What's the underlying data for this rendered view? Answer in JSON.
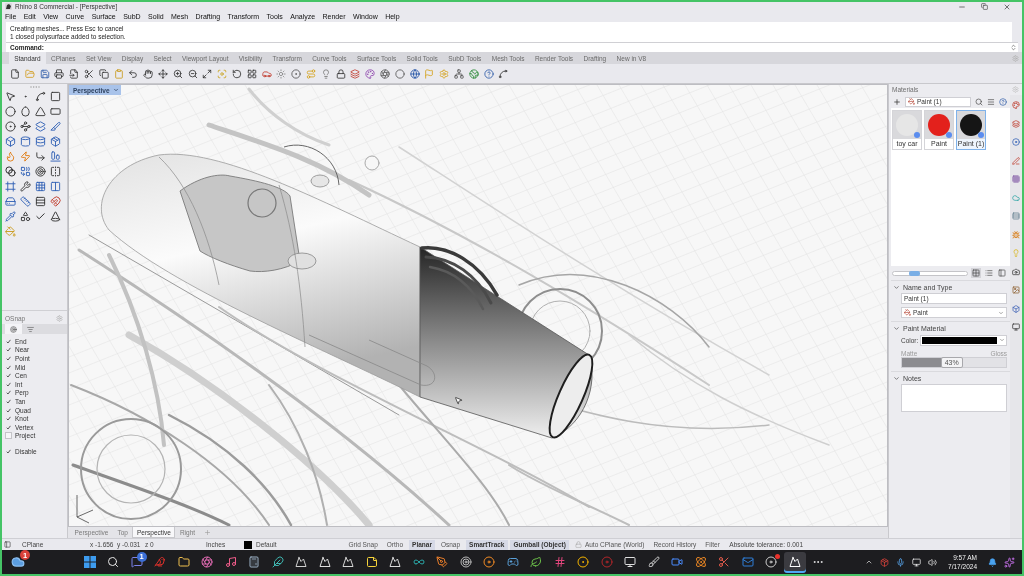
{
  "window": {
    "title": "Rhino 8 Commercial - [Perspective]"
  },
  "menu": [
    "File",
    "Edit",
    "View",
    "Curve",
    "Surface",
    "SubD",
    "Solid",
    "Mesh",
    "Drafting",
    "Transform",
    "Tools",
    "Analyze",
    "Render",
    "Window",
    "Help"
  ],
  "command_history": [
    "Creating meshes... Press Esc to cancel",
    "1 closed polysurface added to selection."
  ],
  "command_prompt": "Command:",
  "ribbon_tabs": [
    {
      "label": "Standard",
      "selected": true
    },
    {
      "label": "CPlanes",
      "selected": false
    },
    {
      "label": "Set View",
      "selected": false
    },
    {
      "label": "Display",
      "selected": false
    },
    {
      "label": "Select",
      "selected": false
    },
    {
      "label": "Viewport Layout",
      "selected": false
    },
    {
      "label": "Visibility",
      "selected": false
    },
    {
      "label": "Transform",
      "selected": false
    },
    {
      "label": "Curve Tools",
      "selected": false
    },
    {
      "label": "Surface Tools",
      "selected": false
    },
    {
      "label": "Solid Tools",
      "selected": false
    },
    {
      "label": "SubD Tools",
      "selected": false
    },
    {
      "label": "Mesh Tools",
      "selected": false
    },
    {
      "label": "Render Tools",
      "selected": false
    },
    {
      "label": "Drafting",
      "selected": false
    },
    {
      "label": "New in V8",
      "selected": false
    }
  ],
  "osnap": {
    "title": "OSnap",
    "tabs": [
      {
        "selected": true
      },
      {
        "selected": false
      }
    ],
    "items": [
      {
        "label": "End",
        "checked": true
      },
      {
        "label": "Near",
        "checked": true
      },
      {
        "label": "Point",
        "checked": true
      },
      {
        "label": "Mid",
        "checked": true
      },
      {
        "label": "Cen",
        "checked": true
      },
      {
        "label": "Int",
        "checked": true
      },
      {
        "label": "Perp",
        "checked": true
      },
      {
        "label": "Tan",
        "checked": true
      },
      {
        "label": "Quad",
        "checked": true
      },
      {
        "label": "Knot",
        "checked": true
      },
      {
        "label": "Vertex",
        "checked": true
      },
      {
        "label": "Project",
        "checked": false
      }
    ],
    "disable": {
      "label": "Disable",
      "checked": true
    }
  },
  "viewport": {
    "title": "Perspective",
    "tabs": [
      {
        "label": "Perspective",
        "selected": false
      },
      {
        "label": "Top",
        "selected": false
      },
      {
        "label": "Perspective",
        "selected": true
      },
      {
        "label": "Right",
        "selected": false
      }
    ]
  },
  "materials": {
    "title": "Materials",
    "filter": "Paint (1)",
    "thumbnails": [
      {
        "label": "toy car",
        "color": "#e6e6e6",
        "selected": false
      },
      {
        "label": "Paint",
        "color": "#e3211c",
        "selected": false
      },
      {
        "label": "Paint (1)",
        "color": "#151515",
        "selected": true
      }
    ],
    "size_slider": {
      "level": 0.28
    },
    "view_buttons": [
      {
        "selected": true
      },
      {
        "selected": false
      },
      {
        "selected": false
      }
    ],
    "name_and_type": {
      "title": "Name and Type",
      "expanded": true,
      "name": "Paint (1)",
      "type": "Paint"
    },
    "paint_material": {
      "title": "Paint Material",
      "expanded": true,
      "color_label": "Color:",
      "color": "#000000",
      "min_label": "Matte",
      "max_label": "Gloss",
      "level": 0.43,
      "reading": "43%"
    },
    "notes": {
      "title": "Notes",
      "expanded": true
    }
  },
  "status_bar": {
    "cplane": "CPlane",
    "coordinates": [
      "x -1.656",
      "y -0.031",
      "z 0"
    ],
    "units": "Inches",
    "layer": {
      "name": "Default",
      "color": "#000000"
    },
    "panes": [
      {
        "label": "Grid Snap",
        "on": false,
        "kind": "toggle"
      },
      {
        "label": "Ortho",
        "on": false,
        "kind": "toggle"
      },
      {
        "label": "Planar",
        "on": true,
        "kind": "toggle"
      },
      {
        "label": "Osnap",
        "on": false,
        "kind": "toggle"
      },
      {
        "label": "SmartTrack",
        "on": true,
        "kind": "toggle"
      },
      {
        "label": "Gumball (Object)",
        "on": true,
        "kind": "toggle"
      },
      {
        "label": "Auto CPlane (World)",
        "on": false,
        "kind": "lock"
      },
      {
        "label": "Record History",
        "on": false,
        "kind": "toggle"
      },
      {
        "label": "Filter",
        "on": false,
        "kind": "toggle"
      }
    ],
    "tolerance": "Absolute tolerance: 0.001"
  },
  "taskbar": {
    "weather": {
      "badge": "1"
    },
    "items": [
      {
        "selected": false,
        "alert": false
      },
      {
        "selected": false,
        "alert": false
      },
      {
        "selected": false,
        "alert": false,
        "badge": "1"
      },
      {
        "selected": false,
        "alert": false
      },
      {
        "selected": false,
        "alert": false
      },
      {
        "selected": false,
        "alert": false
      },
      {
        "selected": false,
        "alert": false
      },
      {
        "selected": false,
        "alert": false
      },
      {
        "selected": false,
        "alert": false
      },
      {
        "selected": false,
        "alert": false
      },
      {
        "selected": false,
        "alert": false
      },
      {
        "selected": false,
        "alert": false
      },
      {
        "selected": false,
        "alert": false
      },
      {
        "selected": false,
        "alert": false
      },
      {
        "selected": false,
        "alert": false
      },
      {
        "selected": false,
        "alert": false
      },
      {
        "selected": false,
        "alert": false
      },
      {
        "selected": false,
        "alert": false
      },
      {
        "selected": false,
        "alert": false
      },
      {
        "selected": false,
        "alert": false
      },
      {
        "selected": false,
        "alert": false
      },
      {
        "selected": false,
        "alert": false
      },
      {
        "selected": false,
        "alert": false
      },
      {
        "selected": false,
        "alert": false
      },
      {
        "selected": false,
        "alert": false
      },
      {
        "selected": false,
        "alert": false
      },
      {
        "selected": false,
        "alert": false
      },
      {
        "selected": false,
        "alert": false
      },
      {
        "selected": false,
        "alert": false
      },
      {
        "selected": false,
        "alert": true
      },
      {
        "selected": true,
        "alert": false
      },
      {
        "selected": false,
        "alert": false
      }
    ],
    "time": "9:57 AM",
    "date": "7/17/2024"
  }
}
